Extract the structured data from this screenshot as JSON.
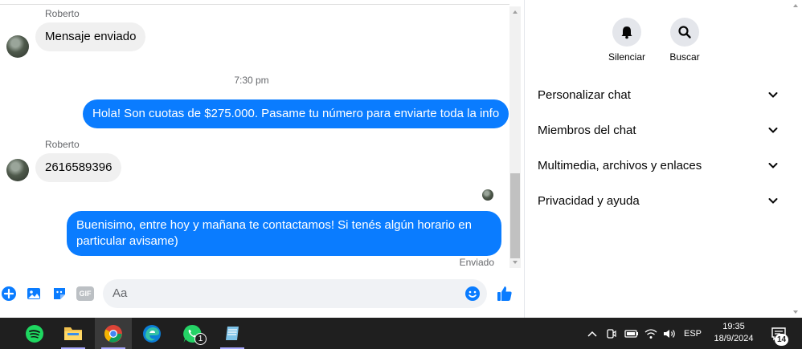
{
  "chat": {
    "messages": {
      "sender_1": "Roberto",
      "msg_1": "Mensaje enviado",
      "time_divider": "7:30 pm",
      "msg_2": "Hola! Son cuotas de $275.000. Pasame tu número para enviarte toda la info",
      "sender_2": "Roberto",
      "msg_3": "2616589396",
      "msg_4_line_1": "Buenisimo, entre hoy y mañana te contactamos! Si tenés algún horario en",
      "msg_4_line_2": "particular avisame)",
      "status": "Enviado"
    },
    "composer": {
      "placeholder": "Aa",
      "gif_label": "GIF"
    },
    "colors": {
      "accent": "#0a7cff",
      "incoming_bg": "#f0f0f0"
    }
  },
  "panel": {
    "actions": [
      {
        "label": "Silenciar",
        "icon": "bell-icon"
      },
      {
        "label": "Buscar",
        "icon": "search-icon"
      }
    ],
    "menu": [
      {
        "label": "Personalizar chat"
      },
      {
        "label": "Miembros del chat"
      },
      {
        "label": "Multimedia, archivos y enlaces"
      },
      {
        "label": "Privacidad y ayuda"
      }
    ]
  },
  "taskbar": {
    "apps": [
      "spotify-icon",
      "file-explorer-icon",
      "chrome-icon",
      "edge-icon",
      "whatsapp-icon",
      "notepad-icon"
    ],
    "whatsapp_badge": "1",
    "language": "ESP",
    "time": "19:35",
    "date": "18/9/2024",
    "notifications_count": "14"
  }
}
